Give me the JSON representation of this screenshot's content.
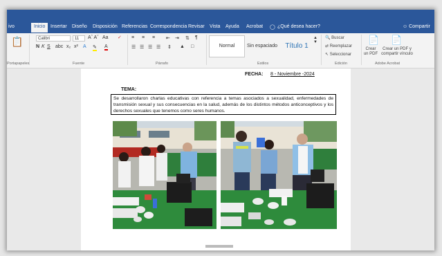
{
  "tabs": [
    "Inicio",
    "Insertar",
    "Diseño",
    "Disposición",
    "Referencias",
    "Correspondencia",
    "Revisar",
    "Vista",
    "Ayuda",
    "Acrobat",
    "¿Qué desea hacer?"
  ],
  "left_partial_tab": "ivo",
  "share_label": "Compartir",
  "font": {
    "name": "Calibri",
    "size": "11"
  },
  "groups": {
    "portapapeles": "Portapapeles",
    "fuente": "Fuente",
    "parrafo": "Párrafo",
    "estilos": "Estilos",
    "edicion": "Edición",
    "acrobat": "Adobe Acrobat"
  },
  "styles": [
    "Normal",
    "Sin espaciado",
    "Título 1"
  ],
  "editing": [
    "Buscar",
    "Reemplazar",
    "Seleccionar"
  ],
  "acrobat": [
    "Crear un PDF",
    "Crear un PDF y compartir vínculo"
  ],
  "document": {
    "fecha_label": "FECHA:",
    "fecha_value": "8 - Noviembre -2024",
    "tema_label": "TEMA:",
    "tema_text": "Se desarrollaron charlas educativas con referencia a temas asociados a sexualidad, enfermedades de transmisión sexual y sus consecuencias en la salud, además de los distintos métodos anticonceptivos y los derechos sexuales que tenemos como seres humanos."
  },
  "colors": {
    "accent": "#2b579a",
    "ribbon_bg": "#f3f3f3",
    "tablecloth": "#2e8b3c"
  }
}
